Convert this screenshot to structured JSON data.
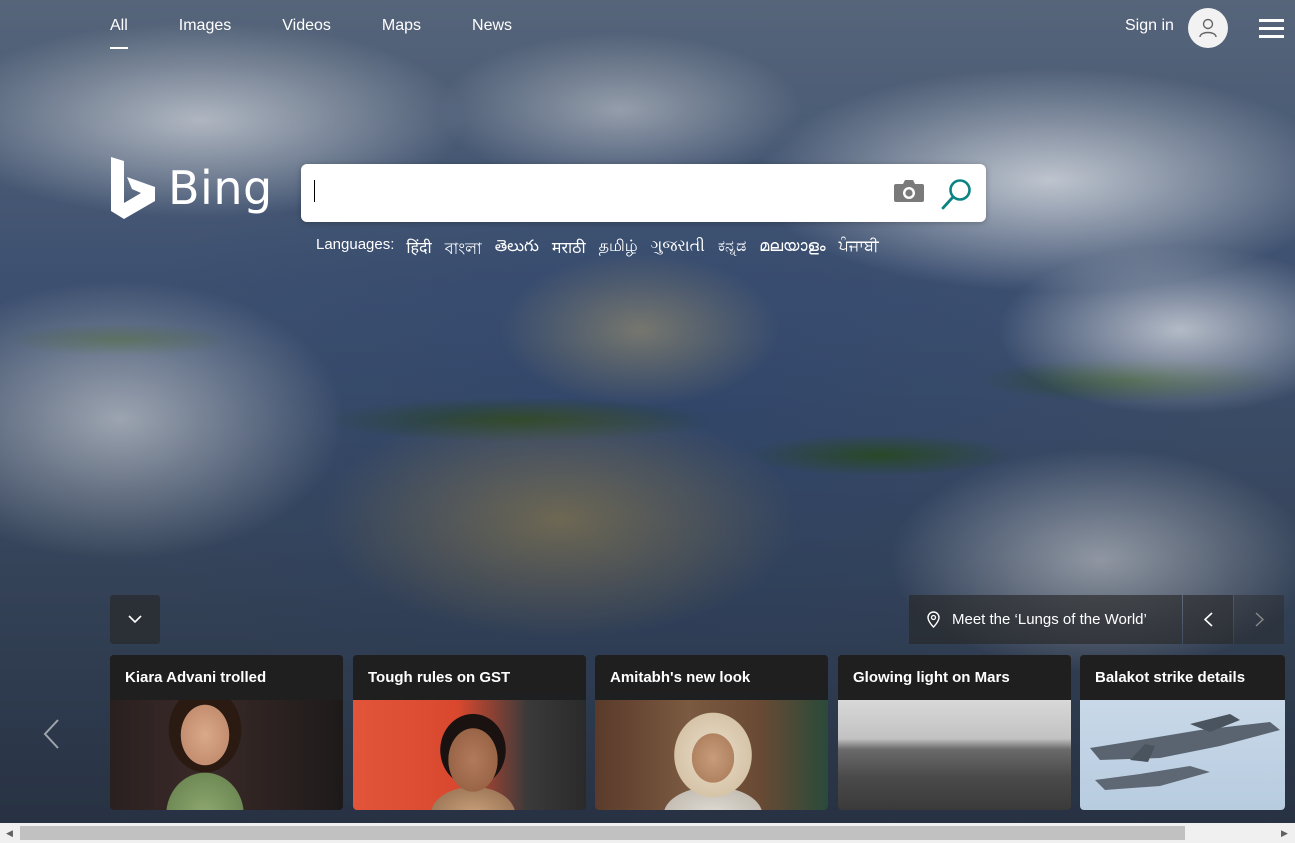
{
  "nav": {
    "tabs": [
      {
        "label": "All"
      },
      {
        "label": "Images"
      },
      {
        "label": "Videos"
      },
      {
        "label": "Maps"
      },
      {
        "label": "News"
      }
    ],
    "active_tab": "All",
    "sign_in": "Sign in",
    "icons": {
      "avatar": "user-icon",
      "menu": "hamburger-menu-icon"
    }
  },
  "logo": {
    "text": "Bing",
    "icon": "bing-logo-icon"
  },
  "search": {
    "value": "",
    "placeholder": "",
    "icons": {
      "camera": "camera-icon",
      "search": "search-icon"
    }
  },
  "languages": {
    "label": "Languages:",
    "items": [
      "हिंदी",
      "বাংলা",
      "తెలుగు",
      "मराठी",
      "தமிழ்",
      "ગુજરાતી",
      "ಕನ್ನಡ",
      "മലയാളം",
      "ਪੰਜਾਬੀ"
    ]
  },
  "story": {
    "text": "Meet the ‘Lungs of the World’",
    "icon": "location-pin-icon"
  },
  "controls": {
    "collapse_icon": "chevron-down-icon",
    "prev_icon": "chevron-left-icon",
    "next_icon": "chevron-right-icon"
  },
  "cards": [
    {
      "title": "Kiara Advani trolled"
    },
    {
      "title": "Tough rules on GST"
    },
    {
      "title": "Amitabh's new look"
    },
    {
      "title": "Glowing light on Mars"
    },
    {
      "title": "Balakot strike details"
    }
  ],
  "colors": {
    "search_accent": "#0c8484",
    "text": "#ffffff"
  }
}
